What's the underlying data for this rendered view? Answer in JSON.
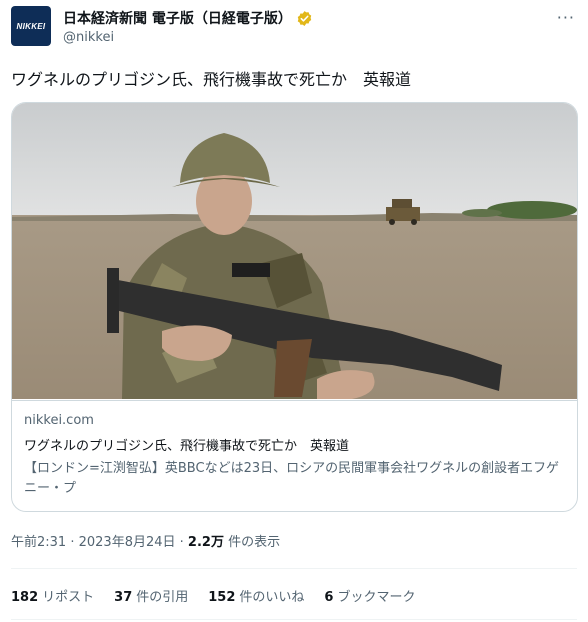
{
  "account": {
    "avatar_text": "NIKKEI",
    "display_name": "日本経済新聞 電子版（日経電子版）",
    "handle": "@nikkei",
    "more_label": "···"
  },
  "tweet": {
    "text": "ワグネルのプリゴジン氏、飛行機事故で死亡か　英報道"
  },
  "card": {
    "domain": "nikkei.com",
    "title": "ワグネルのプリゴジン氏、飛行機事故で死亡か　英報道",
    "description": "【ロンドン=江渕智弘】英BBCなどは23日、ロシアの民間軍事会社ワグネルの創設者エフゲニー・プ"
  },
  "meta": {
    "time": "午前2:31",
    "date": "2023年8月24日",
    "views_count": "2.2万",
    "views_label": "件の表示"
  },
  "stats": [
    {
      "count": "182",
      "label": "リポスト"
    },
    {
      "count": "37",
      "label": "件の引用"
    },
    {
      "count": "152",
      "label": "件のいいね"
    },
    {
      "count": "6",
      "label": "ブックマーク"
    }
  ],
  "colors": {
    "verified_gold": "#e2b719",
    "secondary_text": "#536471",
    "border": "#cfd9de",
    "avatar_bg": "#0e2d57"
  }
}
